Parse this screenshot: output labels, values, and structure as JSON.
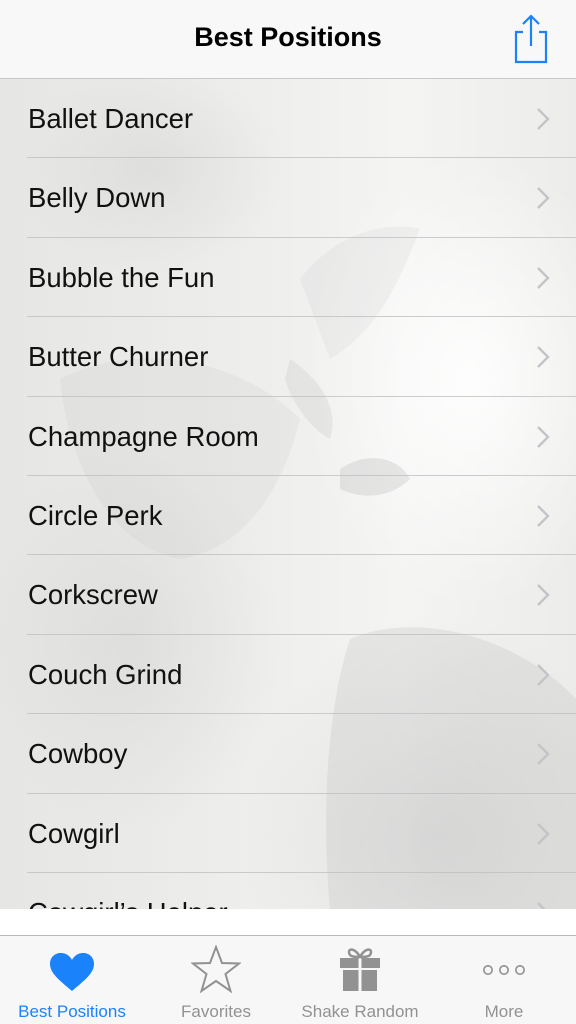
{
  "navbar": {
    "title": "Best Positions",
    "share_icon": "share-icon",
    "accent_color": "#1a82fb"
  },
  "list": {
    "items": [
      {
        "label": "Ballet Dancer"
      },
      {
        "label": "Belly Down"
      },
      {
        "label": "Bubble the Fun"
      },
      {
        "label": "Butter Churner"
      },
      {
        "label": "Champagne Room"
      },
      {
        "label": "Circle Perk"
      },
      {
        "label": "Corkscrew"
      },
      {
        "label": "Couch Grind"
      },
      {
        "label": "Cowboy"
      },
      {
        "label": "Cowgirl"
      },
      {
        "label": "Cowgirl’s Helper"
      }
    ],
    "chevron_icon": "chevron-right-icon"
  },
  "tabbar": {
    "tabs": [
      {
        "label": "Best Positions",
        "icon": "heart-icon",
        "active": true
      },
      {
        "label": "Favorites",
        "icon": "star-icon",
        "active": false
      },
      {
        "label": "Shake Random",
        "icon": "gift-icon",
        "active": false
      },
      {
        "label": "More",
        "icon": "more-dots-icon",
        "active": false
      }
    ],
    "active_color": "#1a82fb",
    "inactive_color": "#929292"
  }
}
